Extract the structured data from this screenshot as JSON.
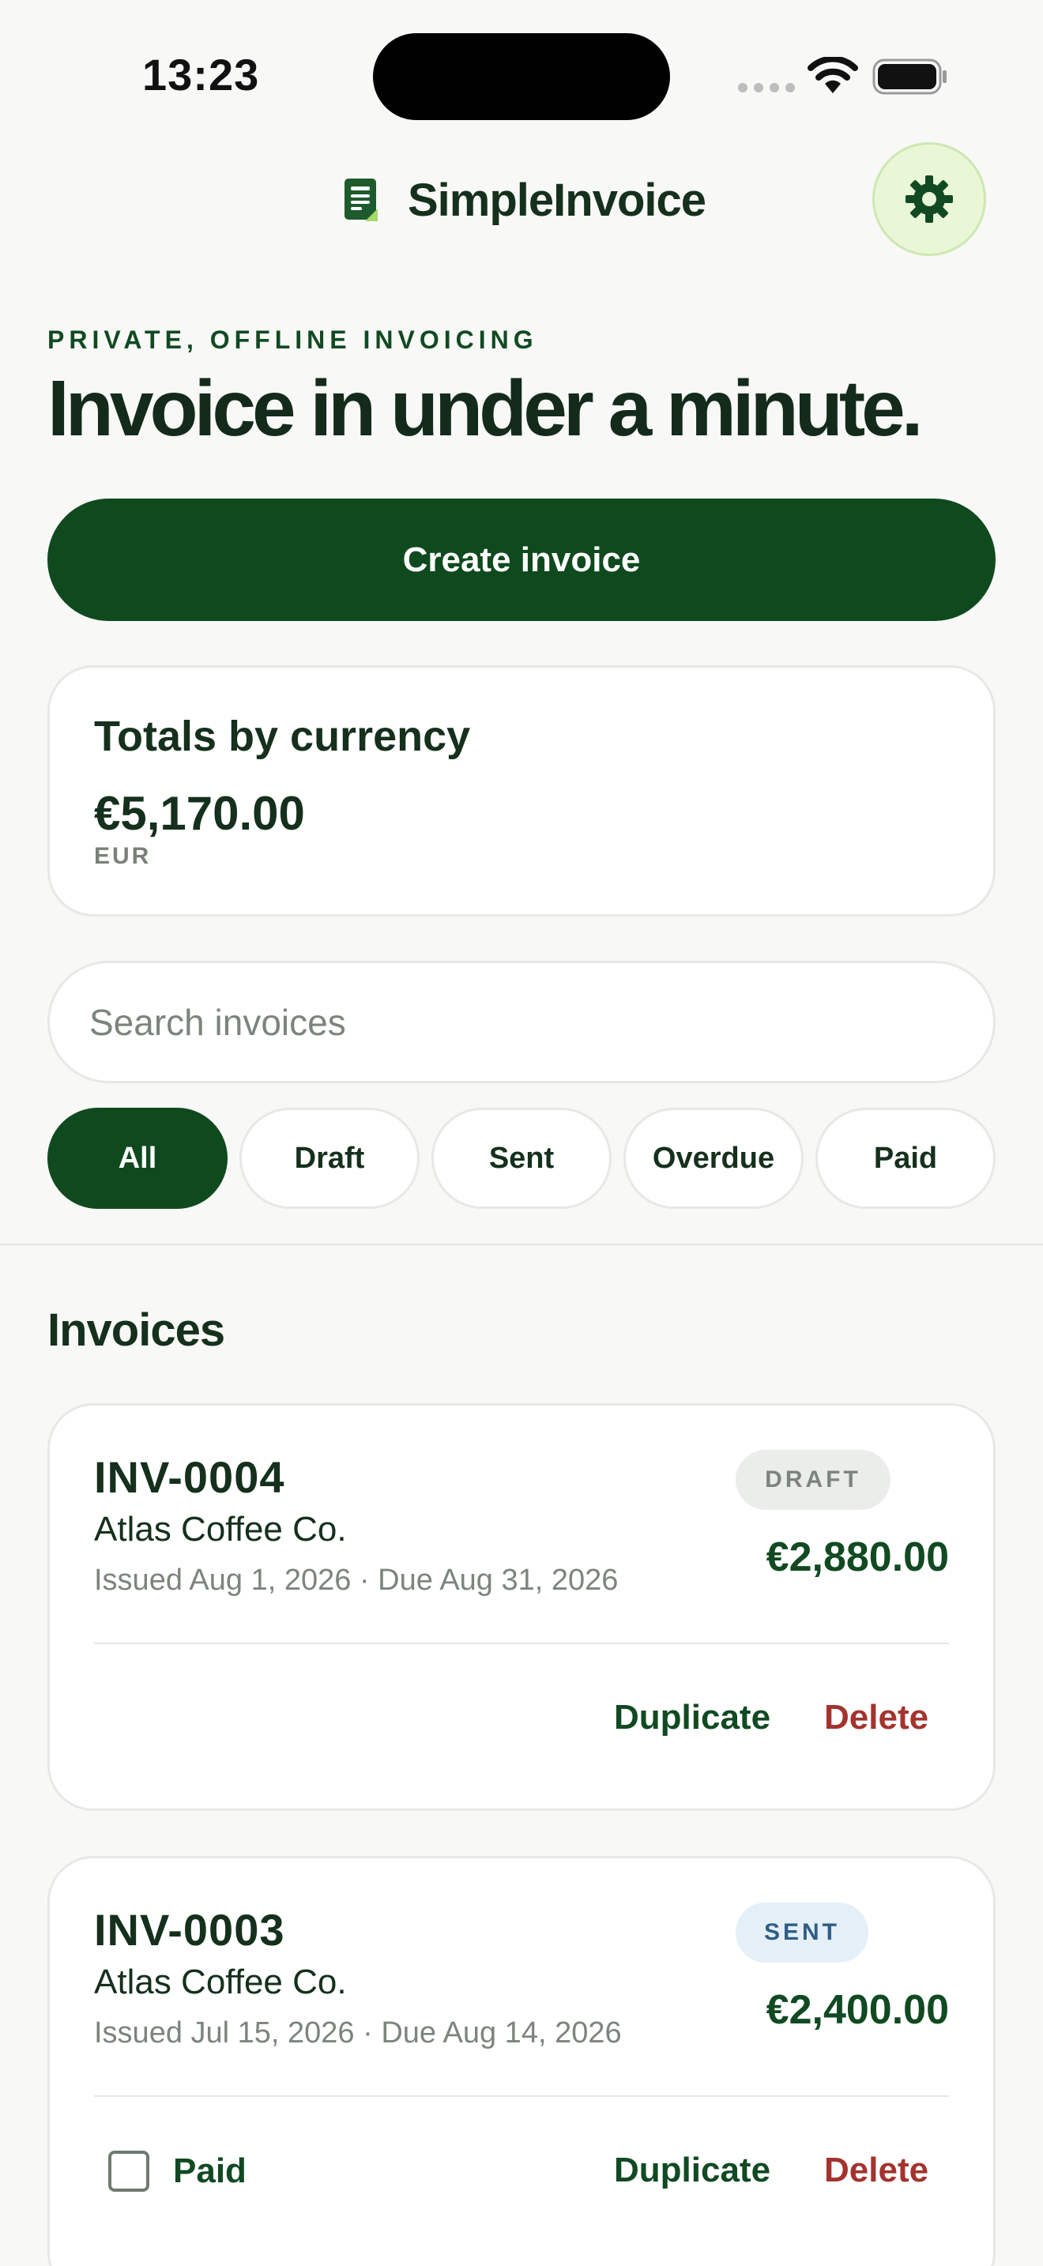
{
  "status_bar": {
    "time": "13:23"
  },
  "header": {
    "app_name": "SimpleInvoice",
    "logo_icon": "invoice-doc-icon",
    "settings_icon": "gear-icon"
  },
  "hero": {
    "eyebrow": "PRIVATE, OFFLINE INVOICING",
    "title": "Invoice in under a minute."
  },
  "create_button": {
    "label": "Create invoice"
  },
  "totals": {
    "title": "Totals by currency",
    "amount": "€5,170.00",
    "currency": "EUR"
  },
  "search": {
    "placeholder": "Search invoices"
  },
  "filters": [
    {
      "label": "All",
      "active": true
    },
    {
      "label": "Draft",
      "active": false
    },
    {
      "label": "Sent",
      "active": false
    },
    {
      "label": "Overdue",
      "active": false
    },
    {
      "label": "Paid",
      "active": false
    }
  ],
  "invoices_section": {
    "title": "Invoices"
  },
  "invoices": [
    {
      "number": "INV-0004",
      "client": "Atlas Coffee Co.",
      "dates": "Issued Aug 1, 2026 · Due Aug 31, 2026",
      "status": "DRAFT",
      "amount": "€2,880.00",
      "duplicate_label": "Duplicate",
      "delete_label": "Delete"
    },
    {
      "number": "INV-0003",
      "client": "Atlas Coffee Co.",
      "dates": "Issued Jul 15, 2026 · Due Aug 14, 2026",
      "status": "SENT",
      "amount": "€2,400.00",
      "paid_label": "Paid",
      "duplicate_label": "Duplicate",
      "delete_label": "Delete"
    }
  ],
  "colors": {
    "primary": "#0f4a1f",
    "danger": "#a3332e",
    "background": "#f8f8f6",
    "settings_bg": "#e9f7d7"
  }
}
